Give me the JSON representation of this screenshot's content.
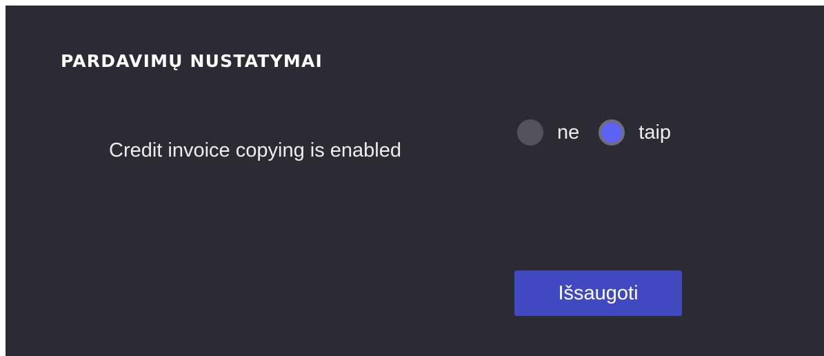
{
  "section": {
    "title": "PARDAVIMŲ NUSTATYMAI"
  },
  "setting": {
    "label": "Credit invoice copying is enabled",
    "options": [
      {
        "label": "ne",
        "selected": false
      },
      {
        "label": "taip",
        "selected": true
      }
    ]
  },
  "actions": {
    "save_label": "Išsaugoti"
  },
  "colors": {
    "background": "#2c2b33",
    "radio_unselected": "#54535b",
    "radio_selected": "#5b63f3",
    "button": "#4149c0",
    "text": "#eeeeee"
  }
}
